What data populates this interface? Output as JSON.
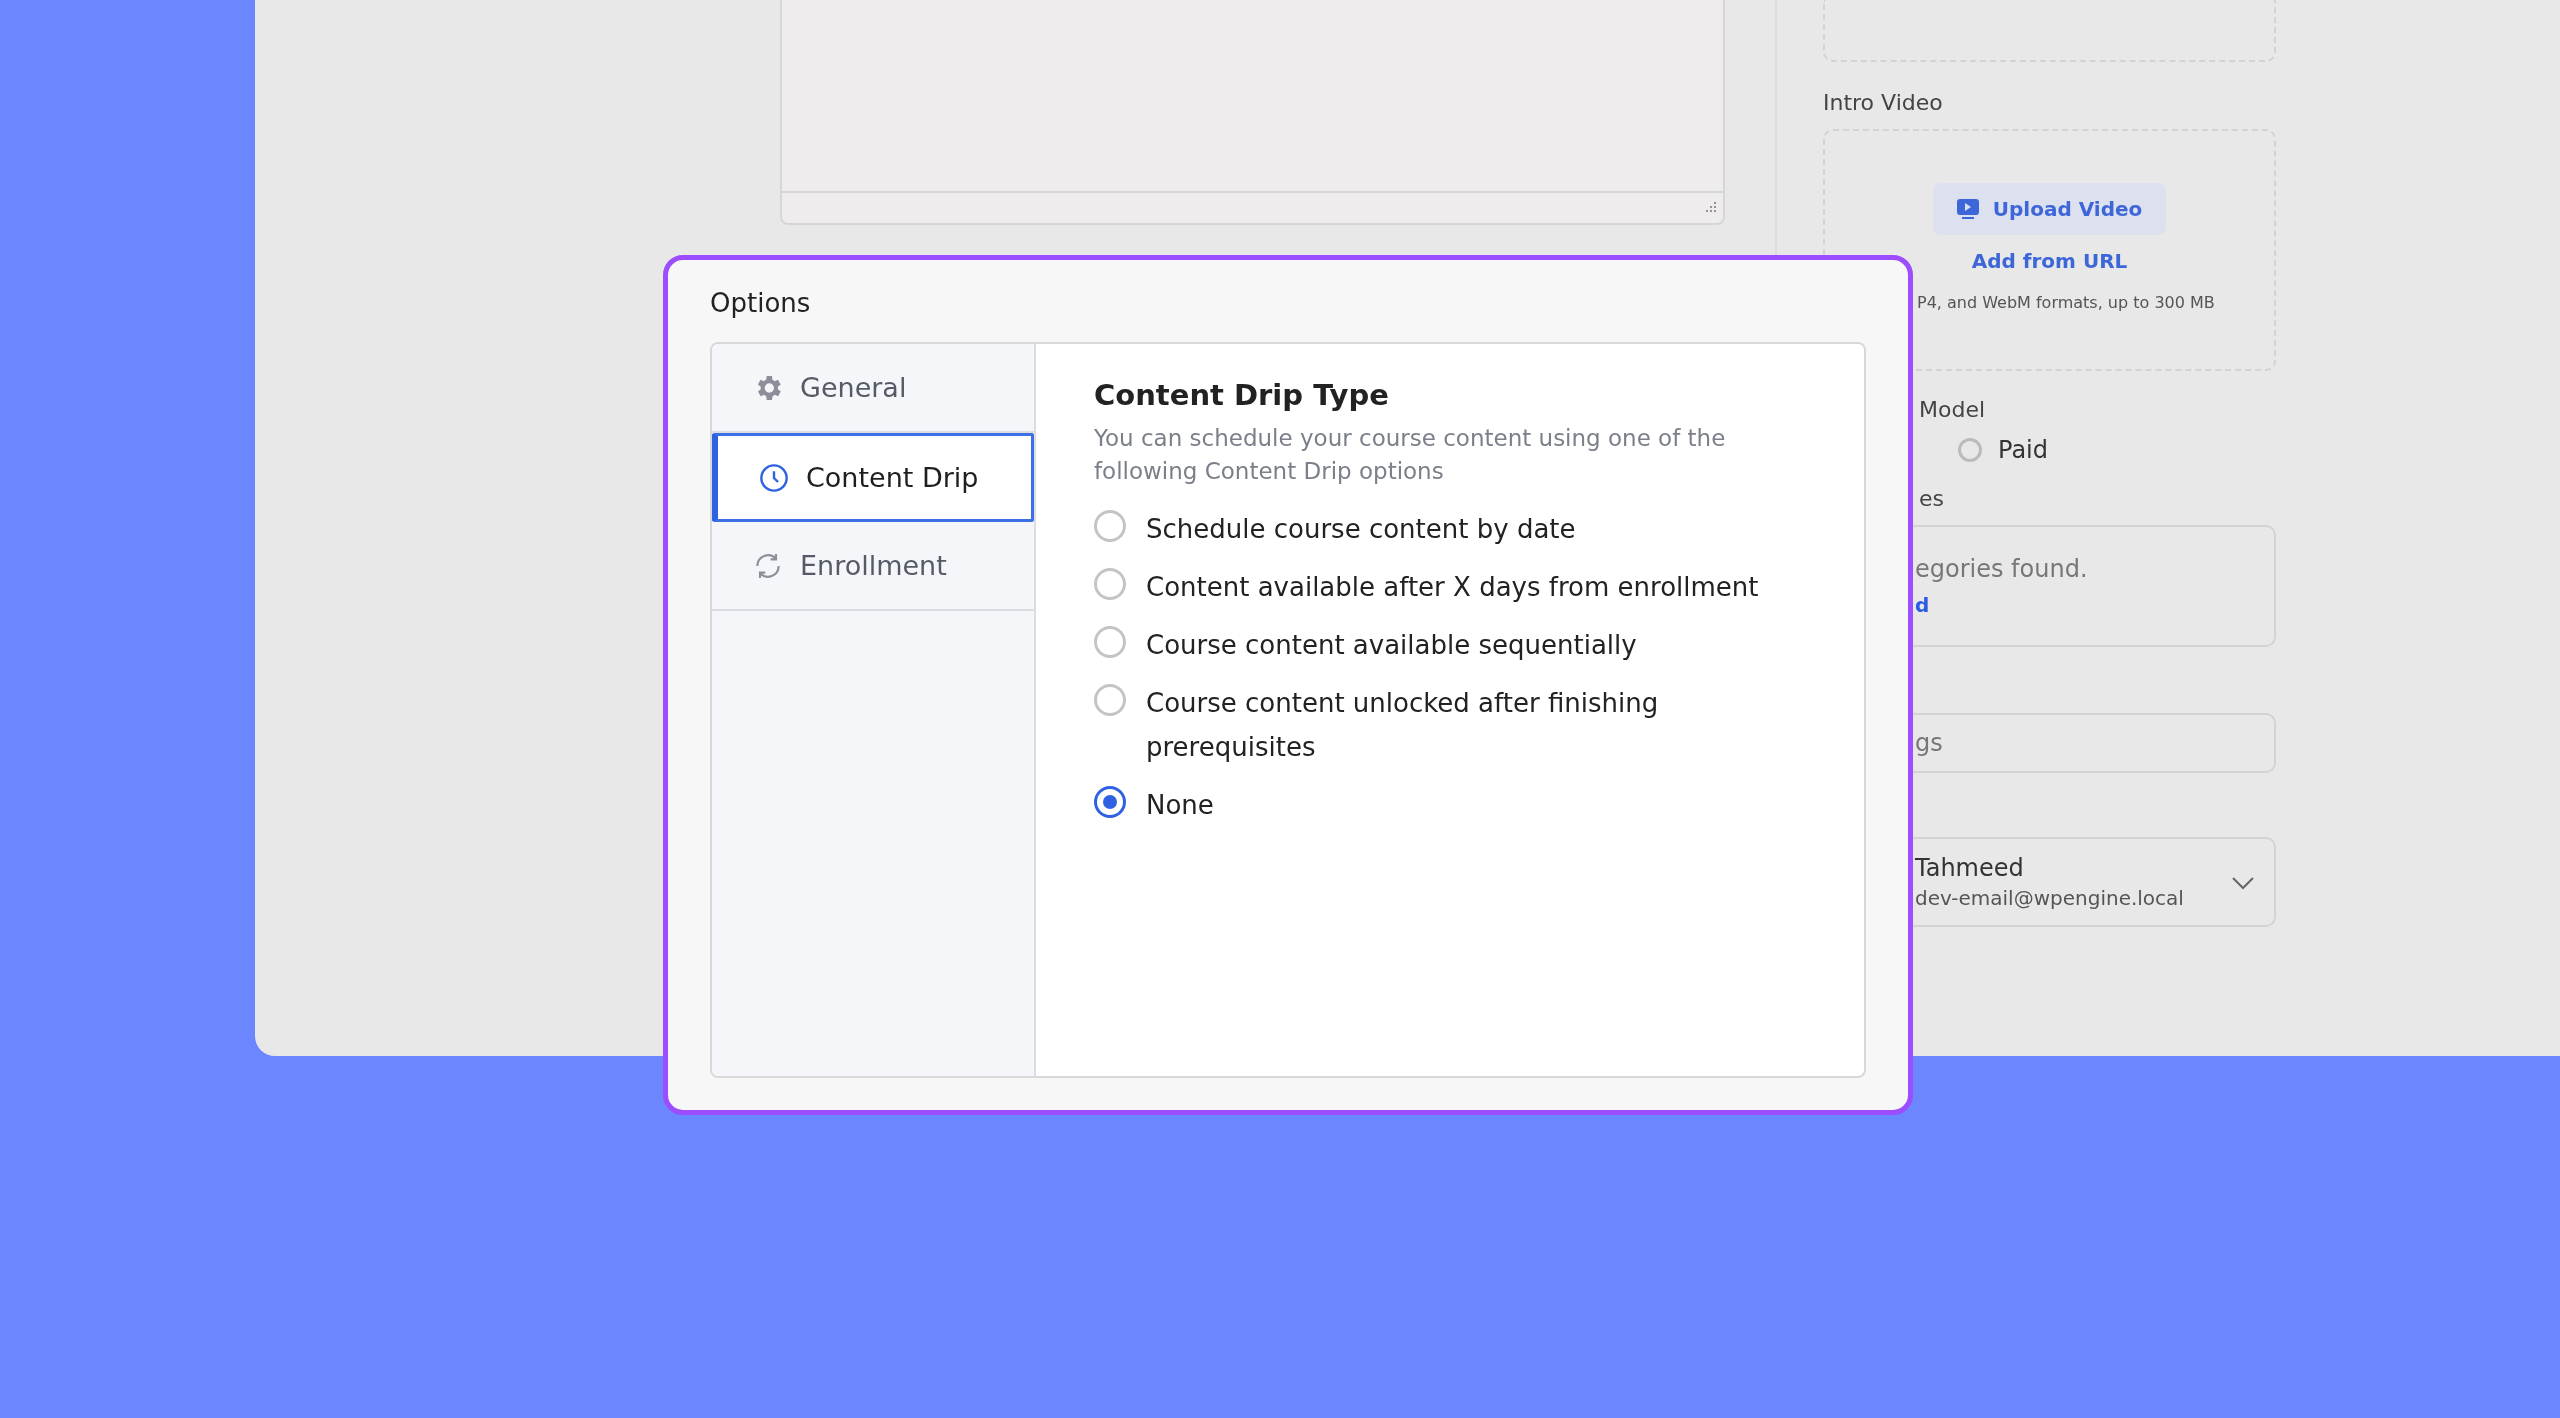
{
  "sidebar": {
    "intro_video": {
      "label": "Intro Video",
      "upload_button": "Upload Video",
      "url_link": "Add from URL",
      "caption": "P4, and WebM formats, up to 300 MB"
    },
    "pricing": {
      "label": "Model",
      "options": [
        {
          "label": "Paid",
          "selected": false
        }
      ]
    },
    "categories": {
      "label": "es",
      "empty_text": "egories found.",
      "link": "d"
    },
    "tags": {
      "placeholder": "gs"
    },
    "instructor": {
      "name": "Tahmeed",
      "email": "dev-email@wpengine.local"
    }
  },
  "modal": {
    "title": "Options",
    "nav": [
      {
        "label": "General",
        "kind": "gear",
        "selected": false
      },
      {
        "label": "Content Drip",
        "kind": "clock",
        "selected": true
      },
      {
        "label": "Enrollment",
        "kind": "refresh",
        "selected": false
      }
    ],
    "section": {
      "heading": "Content Drip Type",
      "description": "You can schedule your course content using one of the following Content Drip options",
      "options": [
        {
          "label": "Schedule course content by date",
          "selected": false
        },
        {
          "label": "Content available after X days from enrollment",
          "selected": false
        },
        {
          "label": "Course content available sequentially",
          "selected": false
        },
        {
          "label": "Course content unlocked after finishing prerequisites",
          "selected": false
        },
        {
          "label": "None",
          "selected": true
        }
      ]
    }
  }
}
